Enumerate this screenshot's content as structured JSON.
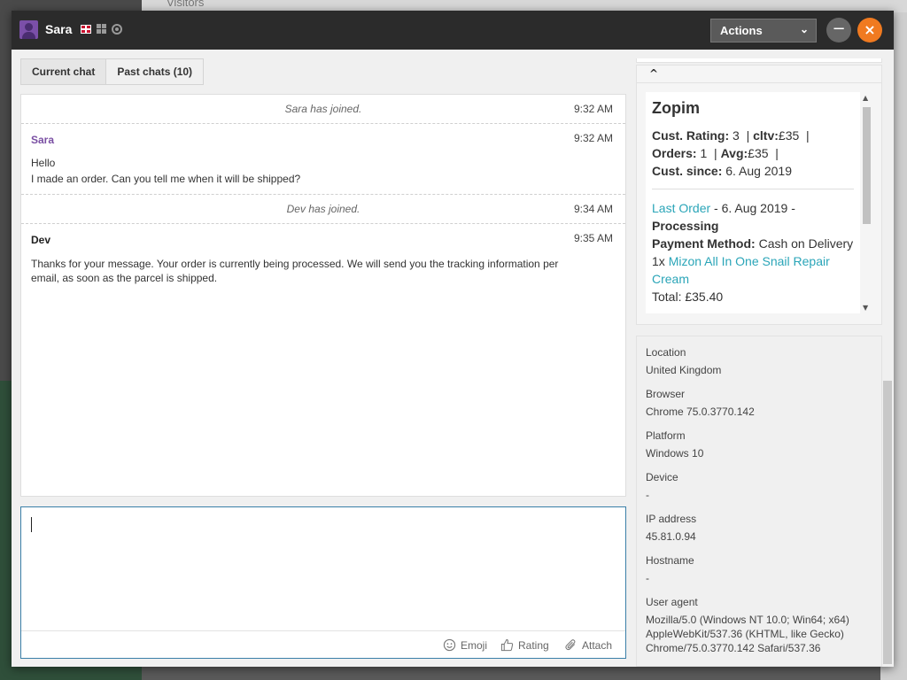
{
  "background": {
    "top_label": "Visitors"
  },
  "window": {
    "visitor_name": "Sara",
    "actions_label": "Actions",
    "minimize_glyph": "−",
    "close_glyph": "×"
  },
  "tabs": [
    {
      "label": "Current chat"
    },
    {
      "label": "Past chats (10)"
    }
  ],
  "chat": {
    "messages": [
      {
        "type": "system",
        "text": "Sara has joined.",
        "time": "9:32 AM"
      },
      {
        "type": "user",
        "author": "Sara",
        "time": "9:32 AM",
        "lines": [
          "Hello",
          "I made an order. Can you tell me when it will be shipped?"
        ]
      },
      {
        "type": "system",
        "text": "Dev has joined.",
        "time": "9:34 AM"
      },
      {
        "type": "agent",
        "author": "Dev",
        "time": "9:35 AM",
        "text": "Thanks for your message. Your order is currently being processed. We will send you the tracking information per email, as soon as the parcel is shipped."
      }
    ]
  },
  "composer": {
    "emoji_label": "Emoji",
    "rating_label": "Rating",
    "attach_label": "Attach"
  },
  "zopim": {
    "title": "Zopim",
    "cust_rating_label": "Cust. Rating:",
    "cust_rating_value": "3",
    "cltv_label": "cltv:",
    "cltv_value": "£35",
    "orders_label": "Orders:",
    "orders_value": "1",
    "avg_label": "Avg:",
    "avg_value": "£35",
    "cust_since_label": "Cust. since:",
    "cust_since_value": "6. Aug 2019",
    "last_order_link": "Last Order",
    "last_order_date": " - 6. Aug 2019 -",
    "last_order_status": "Processing",
    "payment_label": "Payment Method:",
    "payment_value": "Cash on Delivery",
    "item_qty": "1x ",
    "item_link": "Mizon All In One Snail Repair Cream",
    "total_partial": "Total: £35.40"
  },
  "visitor": {
    "location_label": "Location",
    "location_value": "United Kingdom",
    "browser_label": "Browser",
    "browser_value": "Chrome 75.0.3770.142",
    "platform_label": "Platform",
    "platform_value": "Windows 10",
    "device_label": "Device",
    "device_value": "-",
    "ip_label": "IP address",
    "ip_value": "45.81.0.94",
    "hostname_label": "Hostname",
    "hostname_value": "-",
    "ua_label": "User agent",
    "ua_value": "Mozilla/5.0 (Windows NT 10.0; Win64; x64) AppleWebKit/537.36 (KHTML, like Gecko) Chrome/75.0.3770.142 Safari/537.36"
  },
  "colors": {
    "titlebar": "#2b2b2b",
    "close_button": "#f07a20",
    "user_author": "#7a4fa3",
    "link": "#2aa5b8",
    "composer_border": "#3a7fa8"
  }
}
